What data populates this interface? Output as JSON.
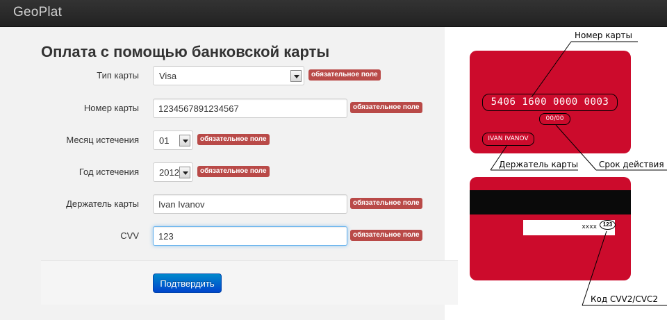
{
  "navbar": {
    "brand": "GeoPlat"
  },
  "page": {
    "title": "Оплата с помощью банковской карты"
  },
  "required_badge": "обязательное поле",
  "form": {
    "card_type": {
      "label": "Тип карты",
      "value": "Visa"
    },
    "card_number": {
      "label": "Номер карты",
      "value": "1234567891234567"
    },
    "exp_month": {
      "label": "Месяц истечения",
      "value": "01"
    },
    "exp_year": {
      "label": "Год истечения",
      "value": "2012"
    },
    "card_holder": {
      "label": "Держатель карты",
      "value": "Ivan Ivanov"
    },
    "cvv": {
      "label": "CVV",
      "value": "123"
    },
    "submit_label": "Подтвердить"
  },
  "illustration": {
    "front": {
      "number": "5406 1600 0000 0003",
      "expiry": "00/00",
      "holder": "IVAN IVANOV"
    },
    "back": {
      "signature_text": "xxxx",
      "cvv": "123"
    },
    "callouts": {
      "number": "Номер карты",
      "holder": "Держатель карты",
      "expiry": "Срок действия",
      "cvv": "Код CVV2/CVC2"
    },
    "colors": {
      "card": "#cc0b2c",
      "stripe": "#0a0a0a"
    }
  }
}
